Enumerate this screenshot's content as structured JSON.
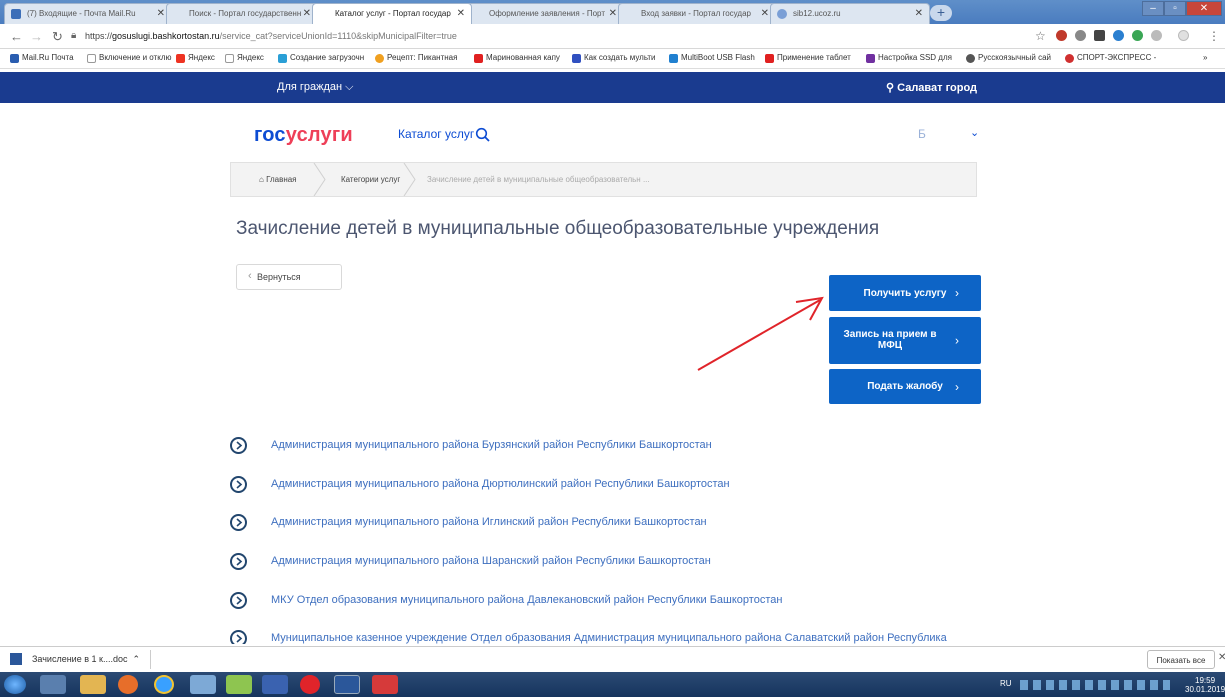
{
  "browser": {
    "tabs": [
      {
        "label": "(7) Входящие - Почта Mail.Ru",
        "color": "#3d6fb8"
      },
      {
        "label": "Поиск - Портал государственн",
        "color": "#d0d0d0"
      },
      {
        "label": "Каталог услуг - Портал государ",
        "color": "#d0d0d0"
      },
      {
        "label": "Оформление заявления - Порт",
        "color": "#d0d0d0"
      },
      {
        "label": "Вход заявки - Портал государ",
        "color": "#d0d0d0"
      },
      {
        "label": "sib12.ucoz.ru",
        "color": "#7a9fd6"
      }
    ],
    "url_protocol": "https://",
    "url_host": "gosuslugi.bashkortostan.ru",
    "url_path": "/service_cat?serviceUnionId=1110&skipMunicipalFilter=true",
    "bookmarks": [
      {
        "label": "Mail.Ru Почта",
        "color": "#2a5db0"
      },
      {
        "label": "Включение и отклю",
        "color": "#999999"
      },
      {
        "label": "Яндекс",
        "color": "#ee3322"
      },
      {
        "label": "Яндекс",
        "color": "#999999"
      },
      {
        "label": "Создание загрузочн",
        "color": "#2a9fd6"
      },
      {
        "label": "Рецепт: Пикантная",
        "color": "#f0a020"
      },
      {
        "label": "Маринованная капу",
        "color": "#e02020"
      },
      {
        "label": "Как создать мульти",
        "color": "#3050c0"
      },
      {
        "label": "MultiBoot USB Flash",
        "color": "#2080d0"
      },
      {
        "label": "Применение таблет",
        "color": "#e02020"
      },
      {
        "label": "Настройка SSD для",
        "color": "#7030a0"
      },
      {
        "label": "Русскоязычный сай",
        "color": "#555555"
      },
      {
        "label": "СПОРТ-ЭКСПРЕСС -",
        "color": "#d03030"
      }
    ]
  },
  "site": {
    "topnav_citizens": "Для граждан ⌵",
    "topnav_city": "Салават город",
    "logo_gos": "гос",
    "logo_usl": "услуги",
    "catalog": "Каталог услуг",
    "user_initial": "Б",
    "brand_blue": "#0d4cd3",
    "brand_red": "#ee3f58"
  },
  "breadcrumbs": {
    "home": "Главная",
    "categories": "Категории услуг",
    "current": "Зачисление детей в муниципальные общеобразовательн ..."
  },
  "page": {
    "title": "Зачисление детей в муниципальные общеобразовательные учреждения",
    "back_label": "Вернуться",
    "get_service": "Получить услугу",
    "appointment_line1": "Запись на прием в",
    "appointment_line2": "МФЦ",
    "complaint": "Подать жалобу"
  },
  "organizations": [
    "Администрация муниципального района Бурзянский район Республики Башкортостан",
    "Администрация муниципального района Дюртюлинский район Республики Башкортостан",
    "Администрация муниципального района Иглинский район Республики Башкортостан",
    "Администрация муниципального района Шаранский район Республики Башкортостан",
    "МКУ Отдел образования муниципального района Давлекановский район Республики Башкортостан",
    "Муниципальное казенное учреждение Отдел образования Администрация муниципального района Салаватский район Республика"
  ],
  "downloads": {
    "file": "Зачисление в 1 к....doc",
    "show_all": "Показать все"
  },
  "taskbar": {
    "lang": "RU",
    "time": "19:59",
    "date": "30.01.2019"
  }
}
